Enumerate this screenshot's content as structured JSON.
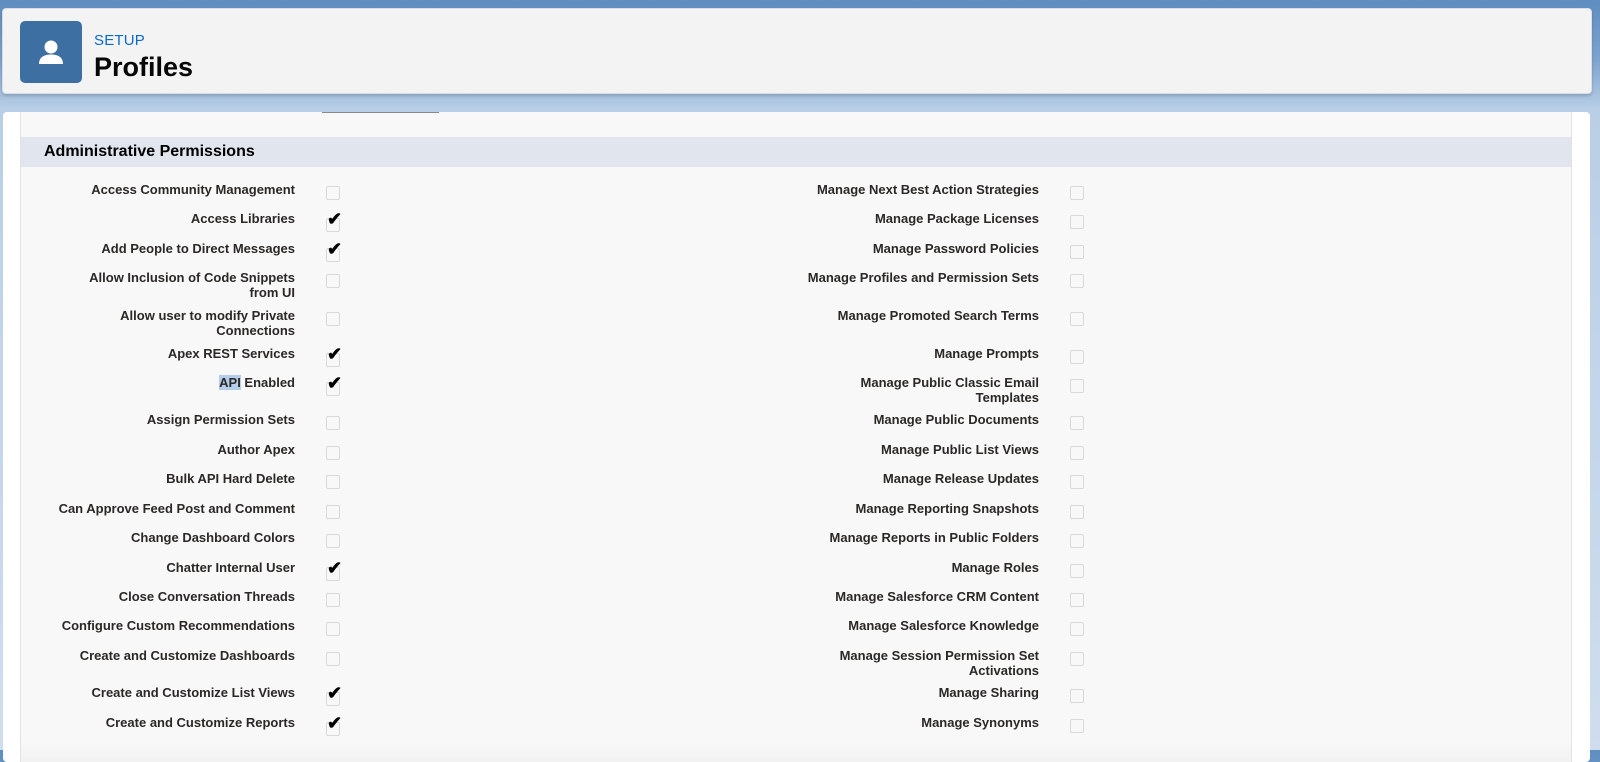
{
  "header": {
    "eyebrow": "SETUP",
    "title": "Profiles",
    "icon": "user-icon"
  },
  "section": {
    "title": "Administrative Permissions"
  },
  "left_permissions": [
    {
      "label_line1": "Access Community Management",
      "label_line2": "",
      "checked": false
    },
    {
      "label_line1": "Access Libraries",
      "label_line2": "",
      "checked": true
    },
    {
      "label_line1": "Add People to Direct Messages",
      "label_line2": "",
      "checked": true
    },
    {
      "label_line1": "Allow Inclusion of Code Snippets",
      "label_line2": "from UI",
      "checked": false
    },
    {
      "label_line1": "Allow user to modify Private",
      "label_line2": "Connections",
      "checked": false
    },
    {
      "label_line1": "Apex REST Services",
      "label_line2": "",
      "checked": true
    },
    {
      "label_highlight": "API",
      "label_rest": " Enabled",
      "checked": true
    },
    {
      "label_line1": "Assign Permission Sets",
      "label_line2": "",
      "checked": false
    },
    {
      "label_line1": "Author Apex",
      "label_line2": "",
      "checked": false
    },
    {
      "label_line1": "Bulk API Hard Delete",
      "label_line2": "",
      "checked": false
    },
    {
      "label_line1": "Can Approve Feed Post and Comment",
      "label_line2": "",
      "checked": false
    },
    {
      "label_line1": "Change Dashboard Colors",
      "label_line2": "",
      "checked": false
    },
    {
      "label_line1": "Chatter Internal User",
      "label_line2": "",
      "checked": true
    },
    {
      "label_line1": "Close Conversation Threads",
      "label_line2": "",
      "checked": false
    },
    {
      "label_line1": "Configure Custom Recommendations",
      "label_line2": "",
      "checked": false
    },
    {
      "label_line1": "Create and Customize Dashboards",
      "label_line2": "",
      "checked": false
    },
    {
      "label_line1": "Create and Customize List Views",
      "label_line2": "",
      "checked": true
    },
    {
      "label_line1": "Create and Customize Reports",
      "label_line2": "",
      "checked": true
    }
  ],
  "right_permissions": [
    {
      "label_line1": "Manage Next Best Action Strategies",
      "label_line2": "",
      "checked": false
    },
    {
      "label_line1": "Manage Package Licenses",
      "label_line2": "",
      "checked": false
    },
    {
      "label_line1": "Manage Password Policies",
      "label_line2": "",
      "checked": false
    },
    {
      "label_line1": "Manage Profiles and Permission Sets",
      "label_line2": "",
      "checked": false
    },
    {
      "label_line1": "Manage Promoted Search Terms",
      "label_line2": "",
      "checked": false
    },
    {
      "label_line1": "Manage Prompts",
      "label_line2": "",
      "checked": false
    },
    {
      "label_line1": "Manage Public Classic Email",
      "label_line2": "Templates",
      "checked": false
    },
    {
      "label_line1": "Manage Public Documents",
      "label_line2": "",
      "checked": false
    },
    {
      "label_line1": "Manage Public List Views",
      "label_line2": "",
      "checked": false
    },
    {
      "label_line1": "Manage Release Updates",
      "label_line2": "",
      "checked": false
    },
    {
      "label_line1": "Manage Reporting Snapshots",
      "label_line2": "",
      "checked": false
    },
    {
      "label_line1": "Manage Reports in Public Folders",
      "label_line2": "",
      "checked": false
    },
    {
      "label_line1": "Manage Roles",
      "label_line2": "",
      "checked": false
    },
    {
      "label_line1": "Manage Salesforce CRM Content",
      "label_line2": "",
      "checked": false
    },
    {
      "label_line1": "Manage Salesforce Knowledge",
      "label_line2": "",
      "checked": false
    },
    {
      "label_line1": "Manage Session Permission Set",
      "label_line2": "Activations",
      "checked": false
    },
    {
      "label_line1": "Manage Sharing",
      "label_line2": "",
      "checked": false
    },
    {
      "label_line1": "Manage Synonyms",
      "label_line2": "",
      "checked": false
    }
  ]
}
